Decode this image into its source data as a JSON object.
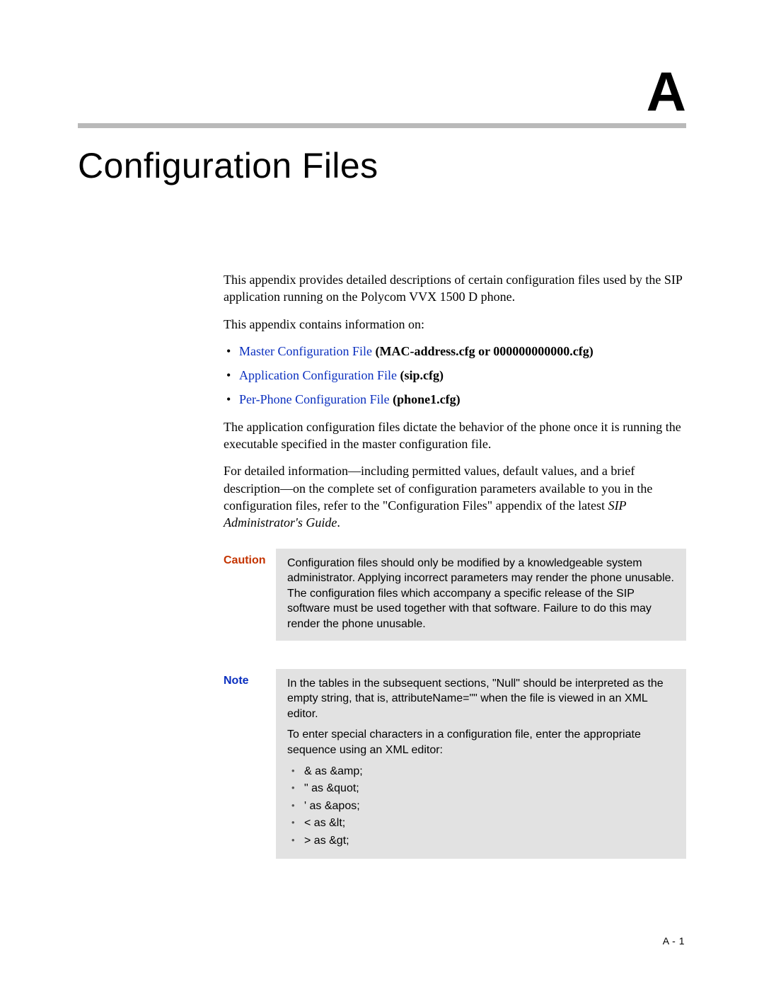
{
  "appendix_letter": "A",
  "title": "Configuration Files",
  "intro_para1": "This appendix provides detailed descriptions of certain configuration files used by the SIP application running on the Polycom VVX 1500 D phone.",
  "intro_para2": "This appendix contains information on:",
  "links": [
    {
      "link": "Master Configuration File",
      "bold": " (MAC-address.cfg or 000000000000.cfg)"
    },
    {
      "link": "Application Configuration File",
      "bold": " (sip.cfg)"
    },
    {
      "link": "Per-Phone Configuration File",
      "bold": " (phone1.cfg)"
    }
  ],
  "after_links_para1": "The application configuration files dictate the behavior of the phone once it is running the executable specified in the master configuration file.",
  "after_links_para2_pre": "For detailed information—including permitted values, default values, and a brief description—on the complete set of configuration parameters available to you in the configuration files, refer to the \"Configuration Files\" appendix of the latest ",
  "after_links_para2_italic": "SIP Administrator's Guide",
  "after_links_para2_post": ".",
  "caution": {
    "label": "Caution",
    "text": "Configuration files should only be modified by a knowledgeable system administrator. Applying incorrect parameters may render the phone unusable. The configuration files which accompany a specific release of the SIP software must be used together with that software. Failure to do this may render the phone unusable."
  },
  "note": {
    "label": "Note",
    "para1": "In the tables in the subsequent sections, \"Null\" should be interpreted as the empty string, that is, attributeName=\"\" when the file is viewed in an XML editor.",
    "para2": "To enter special characters in a configuration file, enter the appropriate sequence using an XML editor:",
    "chars": [
      "& as &amp;",
      "\" as &quot;",
      "' as &apos;",
      "< as &lt;",
      "> as &gt;"
    ]
  },
  "page_number": "A - 1"
}
